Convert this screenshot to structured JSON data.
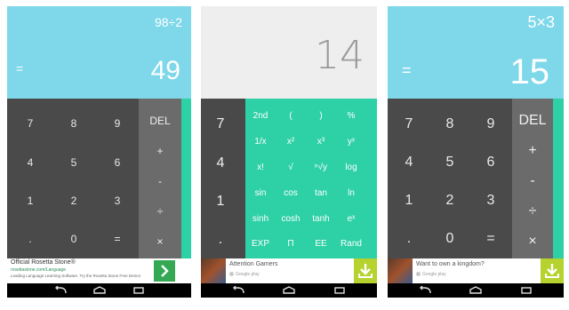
{
  "phones": [
    {
      "expression": "98÷2",
      "equals": "=",
      "result": "49",
      "digits": [
        "7",
        "8",
        "9",
        "4",
        "5",
        "6",
        "1",
        "2",
        "3",
        ".",
        "0",
        "="
      ],
      "ops": [
        "DEL",
        "+",
        "-",
        "÷",
        "×"
      ],
      "ad": {
        "title": "Official Rosetta Stone®",
        "url": "rosettastone.com/Language",
        "description": "Leading Language Learning Software. Try the Rosetta Stone Free Demo!",
        "icon": "chevron-right-icon"
      }
    },
    {
      "result": "14",
      "column": [
        "7",
        "4",
        "1",
        "."
      ],
      "advanced": [
        "2nd",
        "(",
        ")",
        "%",
        "1/x",
        "x²",
        "x³",
        "yˣ",
        "x!",
        "√",
        "ⁿ√y",
        "log",
        "sin",
        "cos",
        "tan",
        "ln",
        "sinh",
        "cosh",
        "tanh",
        "eˣ",
        "EXP",
        "Π",
        "EE",
        "Rand"
      ],
      "ad": {
        "title": "Attention Gamers",
        "source": "Google play",
        "icon": "download-icon"
      }
    },
    {
      "expression": "5×3",
      "equals": "=",
      "result": "15",
      "digits": [
        "7",
        "8",
        "9",
        "4",
        "5",
        "6",
        "1",
        "2",
        "3",
        ".",
        "0",
        "="
      ],
      "ops": [
        "DEL",
        "+",
        "-",
        "÷",
        "×"
      ],
      "ad": {
        "title": "Want to own a kingdom?",
        "source": "Google play",
        "icon": "download-icon"
      }
    }
  ],
  "nav_icons": [
    "back-icon",
    "home-icon",
    "recents-icon"
  ],
  "colors": {
    "display": "#7fd8ea",
    "keypad": "#4a4a4a",
    "operators": "#6b6b6b",
    "advanced_panel": "#2ed0a6",
    "install_button": "#34a853",
    "download_button": "#b5d22e"
  }
}
